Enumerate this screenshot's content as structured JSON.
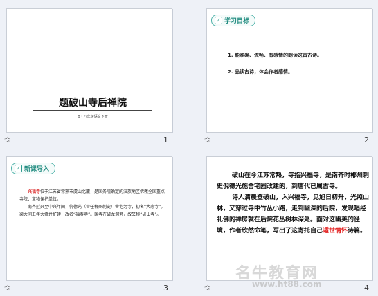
{
  "slides": [
    {
      "number": "1",
      "title": "题破山寺后禅院",
      "subtitle": "B・八年级语文下册"
    },
    {
      "number": "2",
      "tag": "学习目标",
      "goals": [
        "1. 能准确、流畅、有感情的朗读这首古诗。",
        "2. 品读古诗，体会作者感情。"
      ]
    },
    {
      "number": "3",
      "tag": "新课导入",
      "intro_highlight": "兴福寺",
      "intro_p1": "位于江苏省常熟市虞山北麓，是国务院确定的汉族地区佛教全国重点寺院、文物保护单位。",
      "intro_p2": "南齐延兴至中兴年间，倪德光（曾任郴州刺史）舍宅为寺，初名“大悲寺”。梁大同五年大修并扩建，改名“福寿寺”。国寺在破龙洞旁，故又称“破山寺”。"
    },
    {
      "number": "4",
      "poem_p1": "破山在今江苏常熟，寺指兴福寺，是南齐时郴州刺史倪德光施舍宅园改建的，到唐代已属古寺。",
      "poem_p2_a": "诗人清晨登破山，入兴福寺，见旭日初升，光照山林，又穿过寺中竹丛小路，走到幽深的后院，发现唱经礼佛的禅房就在后院花丛树林深处。面对这幽美的径境，作者欣然命笔，写出了这寄托自己",
      "poem_p2_red": "遁世情怀",
      "poem_p2_b": "诗篇。"
    }
  ],
  "watermark": {
    "text": "名牛教育网",
    "url": "www.ht88.com"
  }
}
